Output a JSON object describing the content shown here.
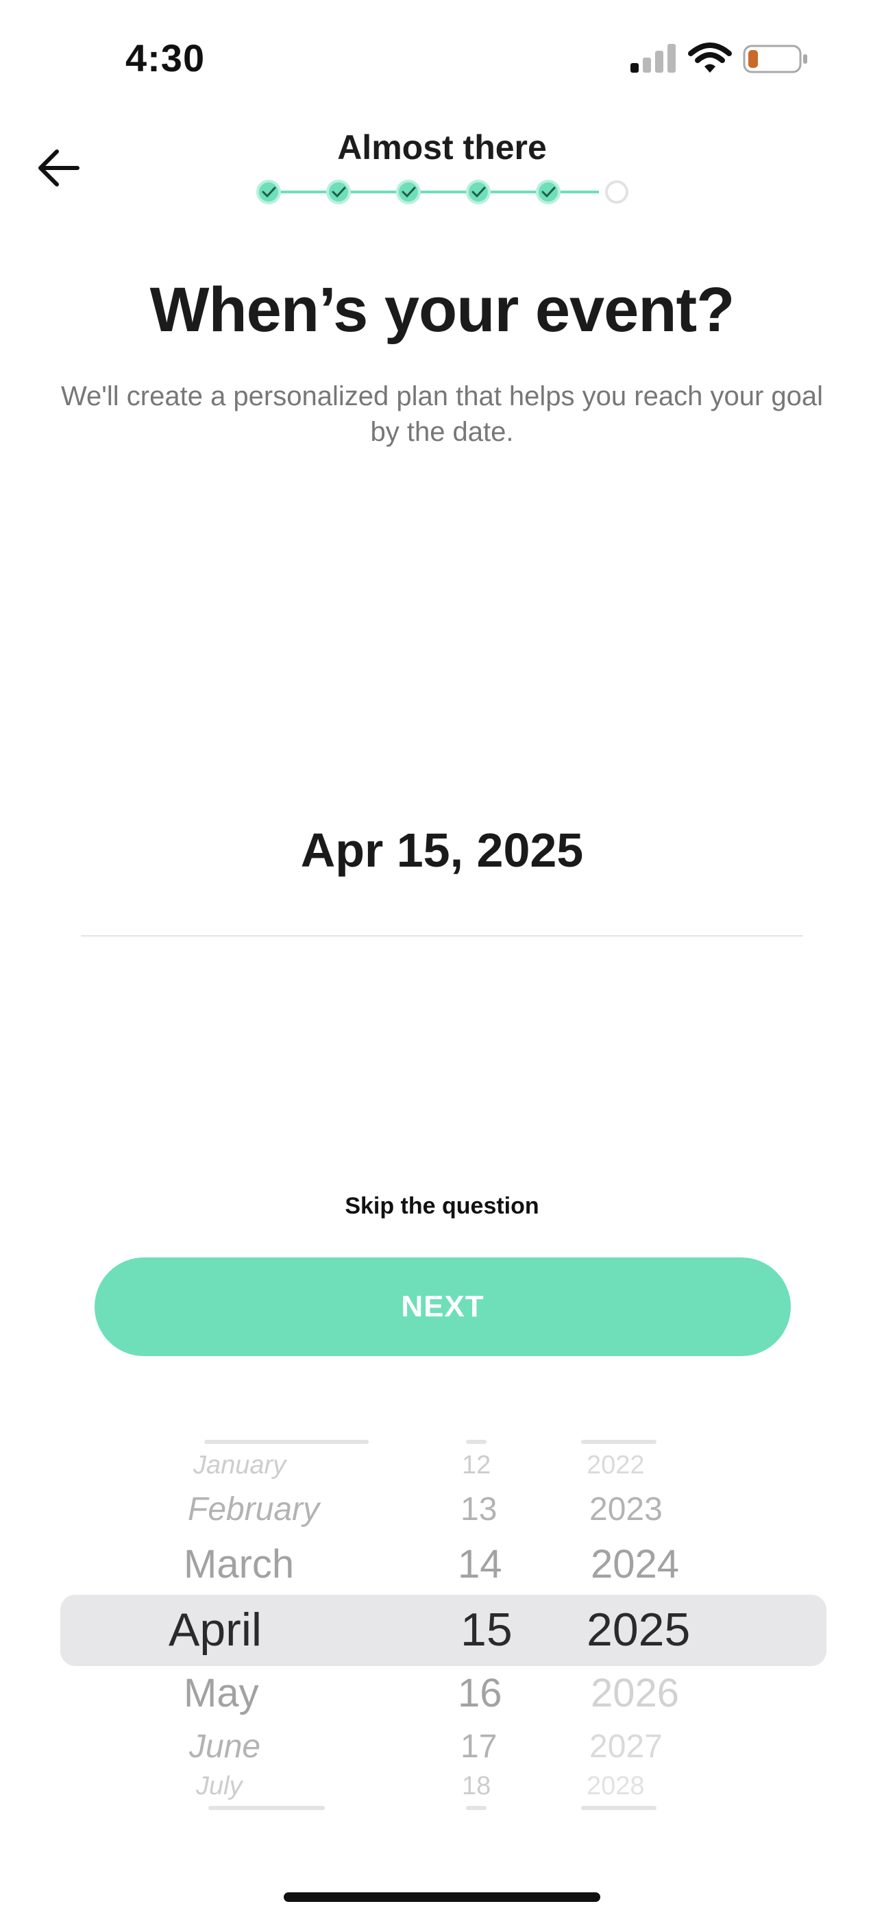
{
  "status_bar": {
    "time": "4:30",
    "signal_icon": "cellular-signal-icon",
    "wifi_icon": "wifi-icon",
    "battery_icon": "battery-low-icon"
  },
  "header": {
    "back_icon": "arrow-left-icon",
    "title": "Almost there",
    "progress": {
      "completed_steps": 5,
      "total_steps": 6,
      "accent_color": "#6edfb8"
    }
  },
  "question": {
    "title": "When’s your event?",
    "subtitle": "We'll create a personalized plan that helps you reach your goal by the date."
  },
  "date_field": {
    "value": "Apr 15, 2025"
  },
  "skip_label": "Skip the question",
  "next_label": "NEXT",
  "picker": {
    "months": {
      "above": [
        "January",
        "February",
        "March"
      ],
      "selected": "April",
      "below": [
        "May",
        "June",
        "July"
      ]
    },
    "days": {
      "above": [
        "12",
        "13",
        "14"
      ],
      "selected": "15",
      "below": [
        "16",
        "17",
        "18"
      ]
    },
    "years": {
      "above": [
        "2022",
        "2023",
        "2024"
      ],
      "selected": "2025",
      "below": [
        "2026",
        "2027",
        "2028"
      ]
    }
  }
}
